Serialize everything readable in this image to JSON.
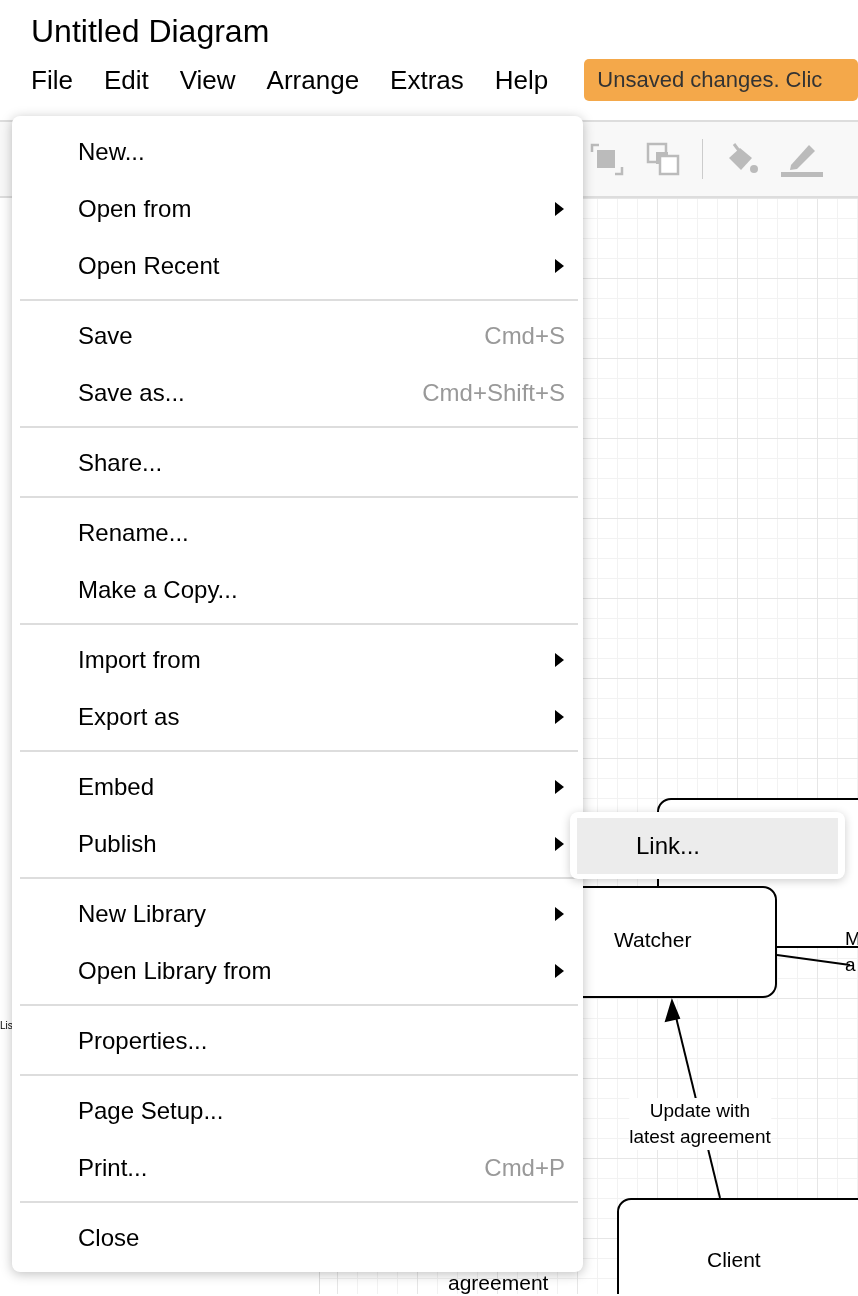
{
  "window": {
    "title": "Untitled Diagram"
  },
  "menubar": [
    {
      "label": "File"
    },
    {
      "label": "Edit"
    },
    {
      "label": "View"
    },
    {
      "label": "Arrange"
    },
    {
      "label": "Extras"
    },
    {
      "label": "Help"
    }
  ],
  "status_badge": "Unsaved changes. Clic",
  "sidebar_fragments": [
    "Lis"
  ],
  "file_menu": {
    "groups": [
      [
        {
          "label": "New...",
          "submenu": false
        },
        {
          "label": "Open from",
          "submenu": true
        },
        {
          "label": "Open Recent",
          "submenu": true
        }
      ],
      [
        {
          "label": "Save",
          "shortcut": "Cmd+S",
          "submenu": false
        },
        {
          "label": "Save as...",
          "shortcut": "Cmd+Shift+S",
          "submenu": false
        }
      ],
      [
        {
          "label": "Share...",
          "submenu": false
        }
      ],
      [
        {
          "label": "Rename...",
          "submenu": false
        },
        {
          "label": "Make a Copy...",
          "submenu": false
        }
      ],
      [
        {
          "label": "Import from",
          "submenu": true
        },
        {
          "label": "Export as",
          "submenu": true
        }
      ],
      [
        {
          "label": "Embed",
          "submenu": true
        },
        {
          "label": "Publish",
          "submenu": true
        }
      ],
      [
        {
          "label": "New Library",
          "submenu": true
        },
        {
          "label": "Open Library from",
          "submenu": true
        }
      ],
      [
        {
          "label": "Properties...",
          "submenu": false
        }
      ],
      [
        {
          "label": "Page Setup...",
          "submenu": false
        },
        {
          "label": "Print...",
          "shortcut": "Cmd+P",
          "submenu": false
        }
      ],
      [
        {
          "label": "Close",
          "submenu": false
        }
      ]
    ]
  },
  "submenu": {
    "items": [
      {
        "label": "Link...",
        "selected": true
      }
    ]
  },
  "diagram": {
    "nodes": [
      {
        "kind": "box"
      },
      {
        "kind": "box",
        "label": "Watcher"
      },
      {
        "kind": "box",
        "label": "Client"
      }
    ],
    "edge_labels": [
      {
        "lines": [
          "Update with",
          "latest agreement"
        ]
      },
      {
        "lines": [
          "M",
          "a"
        ]
      },
      {
        "lines": [
          "agreement"
        ]
      }
    ]
  }
}
